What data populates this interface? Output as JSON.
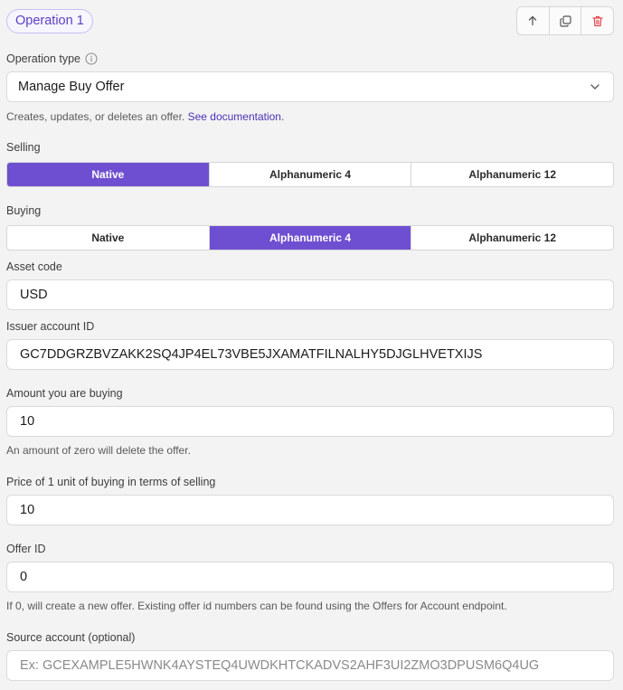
{
  "operation": {
    "badge": "Operation 1"
  },
  "header_actions": {
    "move_up_icon": "arrow-up-icon",
    "duplicate_icon": "duplicate-icon",
    "delete_icon": "trash-icon",
    "delete_color": "#e5484d"
  },
  "operation_type": {
    "label": "Operation type",
    "info_icon": "info-icon",
    "value": "Manage Buy Offer",
    "help_text": "Creates, updates, or deletes an offer. ",
    "help_link": "See documentation",
    "help_end": "."
  },
  "selling": {
    "label": "Selling",
    "options": [
      "Native",
      "Alphanumeric 4",
      "Alphanumeric 12"
    ],
    "selected": "Native"
  },
  "buying": {
    "label": "Buying",
    "options": [
      "Native",
      "Alphanumeric 4",
      "Alphanumeric 12"
    ],
    "selected": "Alphanumeric 4"
  },
  "asset_code": {
    "label": "Asset code",
    "value": "USD"
  },
  "issuer": {
    "label": "Issuer account ID",
    "value": "GC7DDGRZBVZAKK2SQ4JP4EL73VBE5JXAMATFILNALHY5DJGLHVETXIJS"
  },
  "amount": {
    "label": "Amount you are buying",
    "value": "10",
    "help_text": "An amount of zero will delete the offer."
  },
  "price": {
    "label": "Price of 1 unit of buying in terms of selling",
    "value": "10"
  },
  "offer_id": {
    "label": "Offer ID",
    "value": "0",
    "help_text": "If 0, will create a new offer. Existing offer id numbers can be found using the Offers for Account endpoint."
  },
  "source_account": {
    "label": "Source account (optional)",
    "placeholder": "Ex: GCEXAMPLE5HWNK4AYSTEQ4UWDKHTCKADVS2AHF3UI2ZMO3DPUSM6Q4UG"
  },
  "colors": {
    "accent": "#6f4fd1",
    "link": "#4b33b6",
    "background": "#f3f3f3"
  }
}
